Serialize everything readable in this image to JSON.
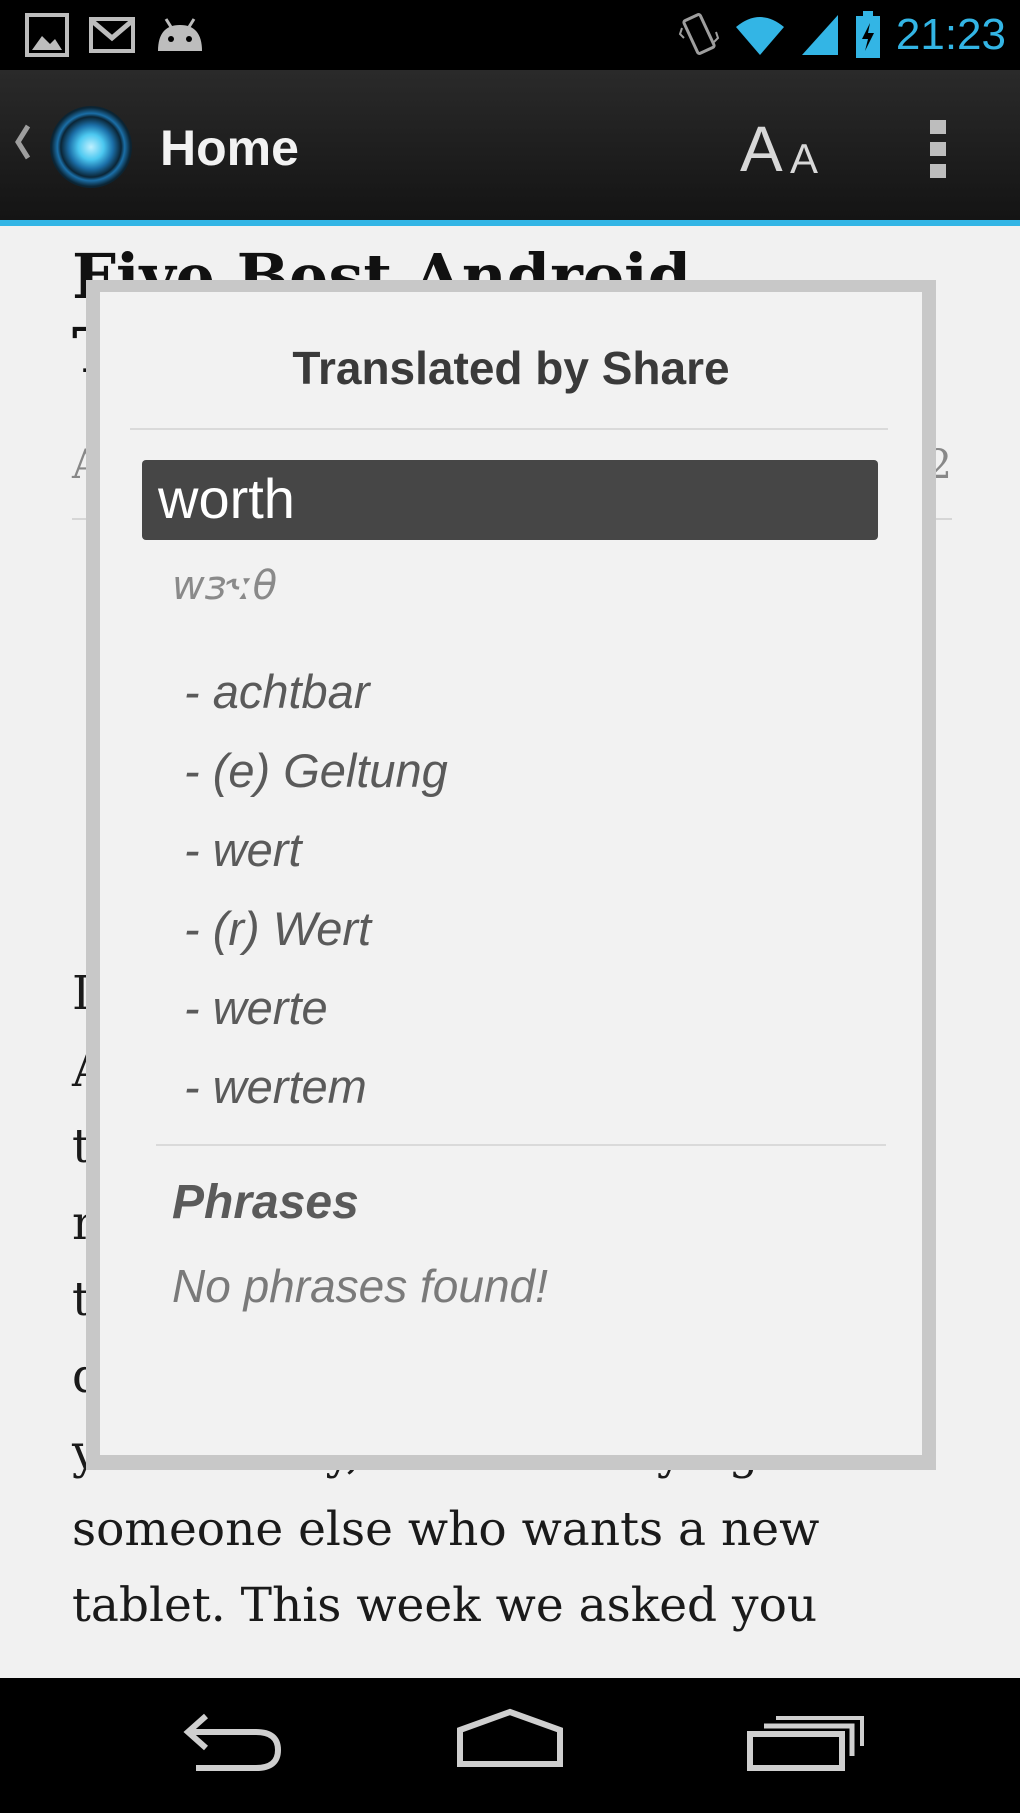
{
  "status_bar": {
    "time": "21:23",
    "left_icons": [
      "gallery-icon",
      "gmail-icon",
      "android-icon"
    ],
    "right_icons": [
      "vibrate-icon",
      "wifi-icon",
      "cell-signal-icon",
      "battery-charging-icon"
    ],
    "accent_color": "#33b5e5"
  },
  "action_bar": {
    "title": "Home",
    "font_size_big": "A",
    "font_size_small": "A",
    "icons": [
      "up-caret-icon",
      "app-icon",
      "overflow-menu-icon"
    ]
  },
  "article": {
    "title_lines": [
      "Five Best Android",
      "T"
    ],
    "meta_left": "A",
    "meta_right": "2",
    "body_lines": [
      "If",
      "A",
      "tl",
      "n",
      "tl",
      "d",
      "your money, or worth buying for",
      "someone else who wants a new",
      "tablet. This week we asked you"
    ]
  },
  "dialog": {
    "title": "Translated by Share",
    "word": "worth",
    "phonetic": "wɜ˞ːθ",
    "translations": [
      "- achtbar",
      "- (e) Geltung",
      "- wert",
      "- (r) Wert",
      "- werte",
      "- wertem"
    ],
    "phrases_heading": "Phrases",
    "phrases_empty": "No phrases found!"
  },
  "nav_bar": {
    "buttons": [
      "back-icon",
      "home-icon",
      "recents-icon"
    ]
  }
}
